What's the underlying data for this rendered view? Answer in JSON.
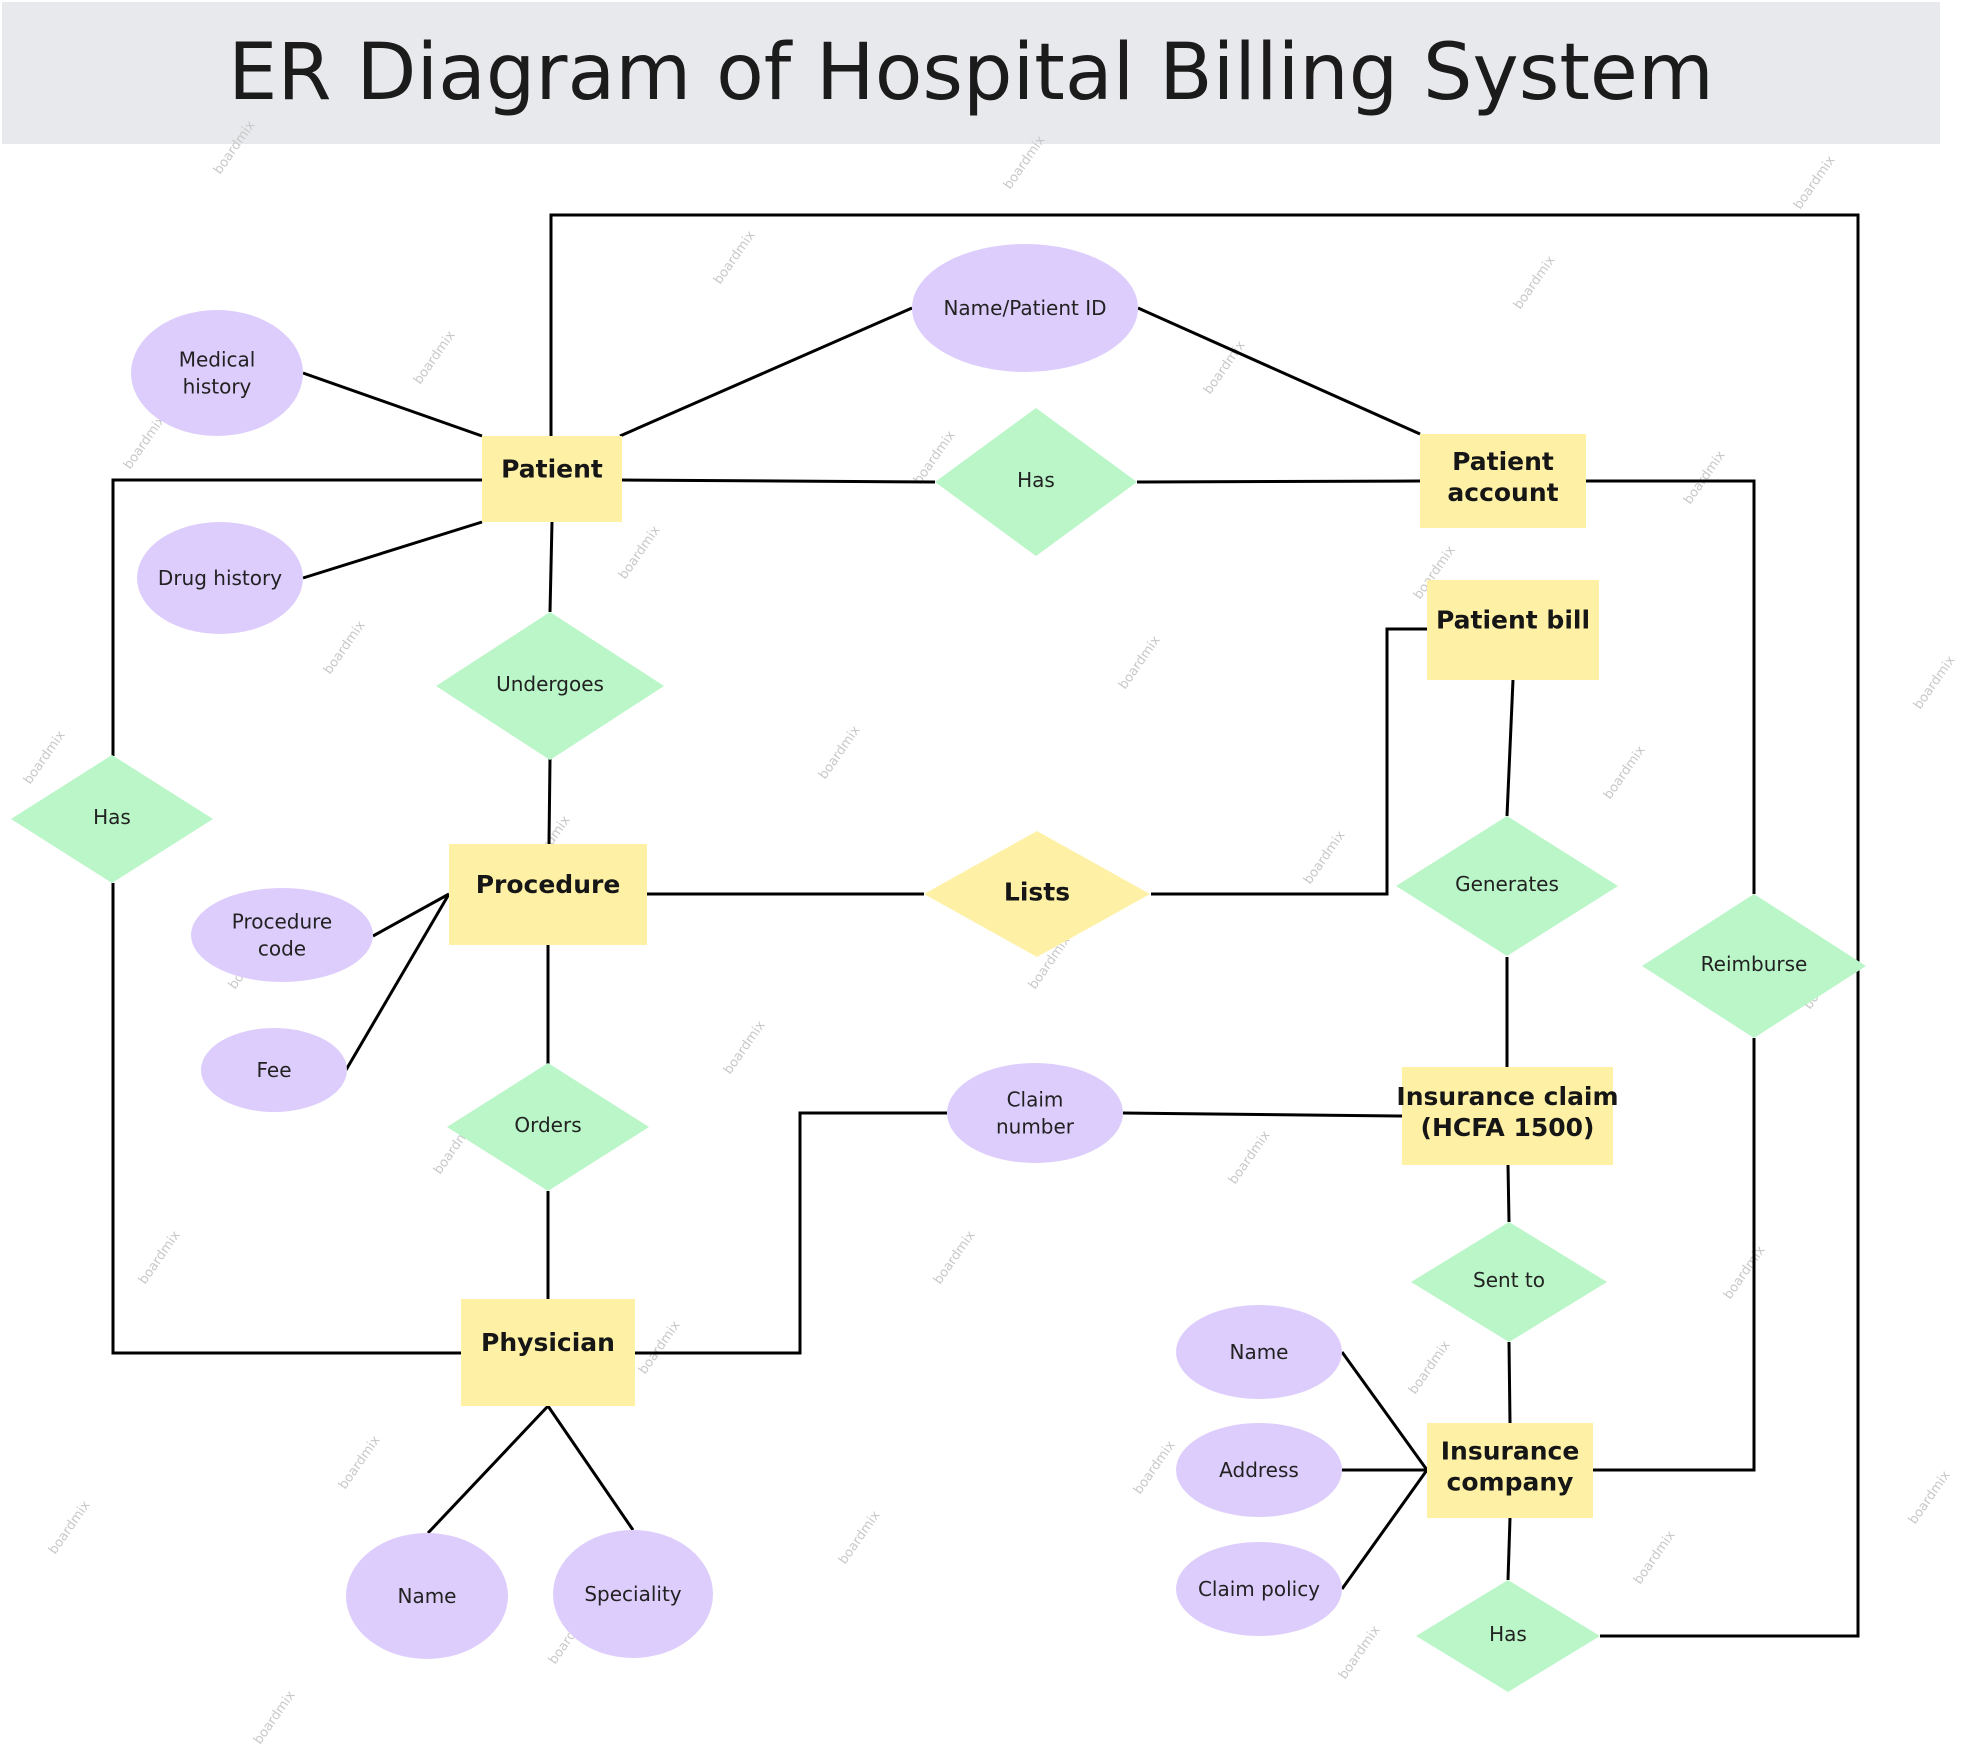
{
  "title": "ER Diagram of Hospital Billing System",
  "colors": {
    "entity": "#fef1a6",
    "relationship": "#baf6c8",
    "relationship_key": "#fef1a6",
    "attribute": "#ddcdfc",
    "line": "#000000",
    "header_bg": "#e8e9ed"
  },
  "watermark": "boardmix",
  "entities": [
    {
      "id": "patient",
      "lines": [
        "Patient"
      ]
    },
    {
      "id": "patient-account",
      "lines": [
        "Patient",
        "account"
      ]
    },
    {
      "id": "patient-bill",
      "lines": [
        "Patient bill"
      ]
    },
    {
      "id": "procedure",
      "lines": [
        "Procedure"
      ]
    },
    {
      "id": "insurance-claim",
      "lines": [
        "Insurance claim",
        "(HCFA 1500)"
      ]
    },
    {
      "id": "physician",
      "lines": [
        "Physician"
      ]
    },
    {
      "id": "insurance-company",
      "lines": [
        "Insurance",
        "company"
      ]
    }
  ],
  "relationships": [
    {
      "id": "has-patient-account",
      "lines": [
        "Has"
      ]
    },
    {
      "id": "undergoes",
      "lines": [
        "Undergoes"
      ]
    },
    {
      "id": "has-physician",
      "lines": [
        "Has"
      ]
    },
    {
      "id": "lists",
      "lines": [
        "Lists"
      ]
    },
    {
      "id": "generates",
      "lines": [
        "Generates"
      ]
    },
    {
      "id": "reimburse",
      "lines": [
        "Reimburse"
      ]
    },
    {
      "id": "orders",
      "lines": [
        "Orders"
      ]
    },
    {
      "id": "sent-to",
      "lines": [
        "Sent to"
      ]
    },
    {
      "id": "has-insurance",
      "lines": [
        "Has"
      ]
    }
  ],
  "attributes": [
    {
      "id": "medical-history",
      "lines": [
        "Medical",
        "history"
      ]
    },
    {
      "id": "drug-history",
      "lines": [
        "Drug history"
      ]
    },
    {
      "id": "name-patient-id",
      "lines": [
        "Name/Patient ID"
      ]
    },
    {
      "id": "procedure-code",
      "lines": [
        "Procedure",
        "code"
      ]
    },
    {
      "id": "fee",
      "lines": [
        "Fee"
      ]
    },
    {
      "id": "claim-number",
      "lines": [
        "Claim",
        "number"
      ]
    },
    {
      "id": "physician-name",
      "lines": [
        "Name"
      ]
    },
    {
      "id": "speciality",
      "lines": [
        "Speciality"
      ]
    },
    {
      "id": "insurer-name",
      "lines": [
        "Name"
      ]
    },
    {
      "id": "address",
      "lines": [
        "Address"
      ]
    },
    {
      "id": "claim-policy",
      "lines": [
        "Claim policy"
      ]
    }
  ]
}
